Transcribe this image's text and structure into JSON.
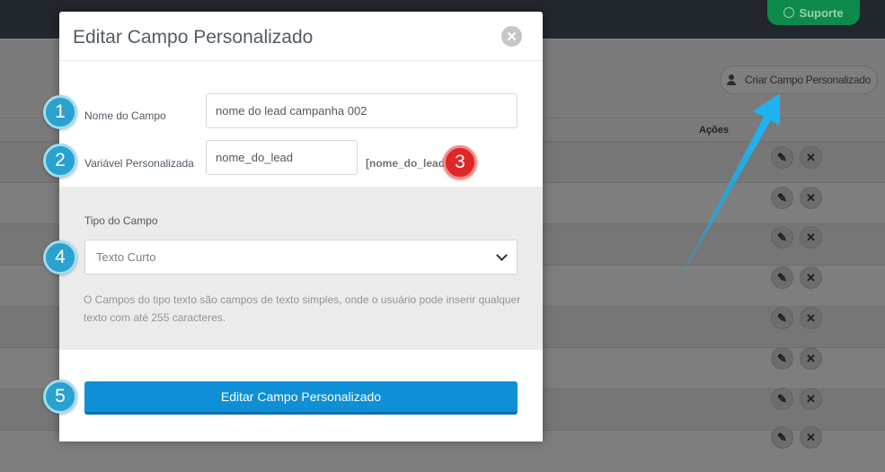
{
  "app": {
    "support_label": "Suporte",
    "create_button_label": "Criar Campo Personalizado",
    "table_actions_header": "Ações",
    "row_edit_icon": "pencil-icon",
    "row_delete_icon": "x-icon"
  },
  "modal": {
    "title": "Editar Campo Personalizado",
    "close_icon": "close-icon",
    "field_name_label": "Nome do Campo",
    "field_name_value": "nome do lead campanha 002",
    "variable_label": "Variável Personalizada",
    "variable_value": "nome_do_lead",
    "variable_tag": "[nome_do_lead]",
    "type_label": "Tipo do Campo",
    "type_selected": "Texto Curto",
    "help_text": "O Campos do tipo texto são campos de texto simples, onde o usuário pode inserir qualquer texto com até 255 caracteres.",
    "submit_label": "Editar Campo Personalizado"
  },
  "steps": [
    "1",
    "2",
    "3",
    "4",
    "5"
  ],
  "colors": {
    "step_badge": "#2aa1cf",
    "step_badge_alert": "#e02727",
    "primary_button": "#0e8fd6",
    "support_button": "#0d8a4c"
  }
}
